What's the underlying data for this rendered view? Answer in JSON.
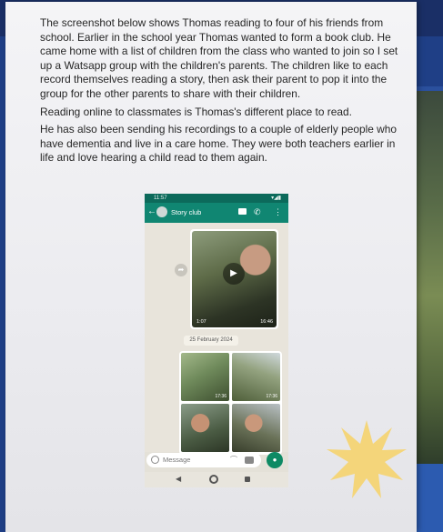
{
  "document": {
    "paragraphs": [
      "The screenshot below shows Thomas reading to four of his friends from school. Earlier in the school year Thomas wanted to form a book club. He came home with a list of children from the class who wanted to join so I set up a Watsapp group with the children's parents. The children like to each record themselves reading a story, then ask their parent to pop it into the group for the other parents to share with their children.",
      "Reading online to classmates is Thomas's different place to read.",
      "He has also been sending his recordings to a couple of elderly people who have dementia and live in a care home. They were both teachers earlier in life and love hearing a child read to them again."
    ]
  },
  "phone": {
    "status_time": "11:57",
    "chat_title": "Story club",
    "video_duration": "1:07",
    "video_time": "16:46",
    "date_separator": "25 February 2024",
    "photo_times": [
      "17:36",
      "17:36",
      "",
      ""
    ],
    "message_placeholder": "Message"
  },
  "icons": {
    "back": "back-arrow-icon",
    "video_call": "video-call-icon",
    "voice_call": "phone-icon",
    "menu": "more-vert-icon",
    "play": "play-icon",
    "forward": "forward-icon",
    "emoji": "emoji-icon",
    "attach": "attach-icon",
    "camera": "camera-icon",
    "mic": "mic-icon"
  },
  "colors": {
    "whatsapp_header": "#108672",
    "whatsapp_status": "#0c6a5b",
    "mic_button": "#0e8a64",
    "sticker": "#f4d57a"
  }
}
